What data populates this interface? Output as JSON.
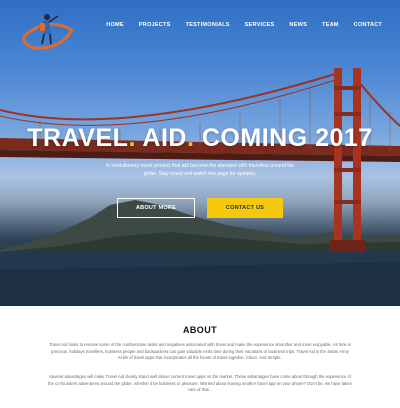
{
  "nav": {
    "items": [
      "HOME",
      "PROJECTS",
      "TESTIMONIALS",
      "SERVICES",
      "NEWS",
      "TEAM",
      "CONTACT"
    ]
  },
  "hero": {
    "title_parts": [
      "TRAVEL",
      ".",
      " AID",
      ".",
      " COMING 2017"
    ],
    "subtitle": "A revolutionary travel product that will become the standard with travellers around the globe. Stay tuned and watch this page for updates.",
    "btn_about": "ABOUT MORE",
    "btn_contact": "CONTACT US",
    "accent": "#f6c511"
  },
  "about": {
    "heading": "ABOUT",
    "p1": "Travel Aid looks to remove some of the cumbersome tasks and negatives associated with travel and make the experience smoother and more enjoyable. As time is precious, holidays travellers, business people and backpackers can gain valuable extra time during their vacations or business trips. Travel Aid is the Swiss Army Knife of travel apps that incorporates all the facets of travel together. Clean. And Simple.",
    "p2": "Several advantages will make Travel Aid clearly stand well above current travel apps on the market. These advantages have come about through the experience of the co-founders adventures around the globe, whether it be business or pleasure. Worried about leaving another travel app on your phone? Don't be, we have taken care of that..."
  }
}
